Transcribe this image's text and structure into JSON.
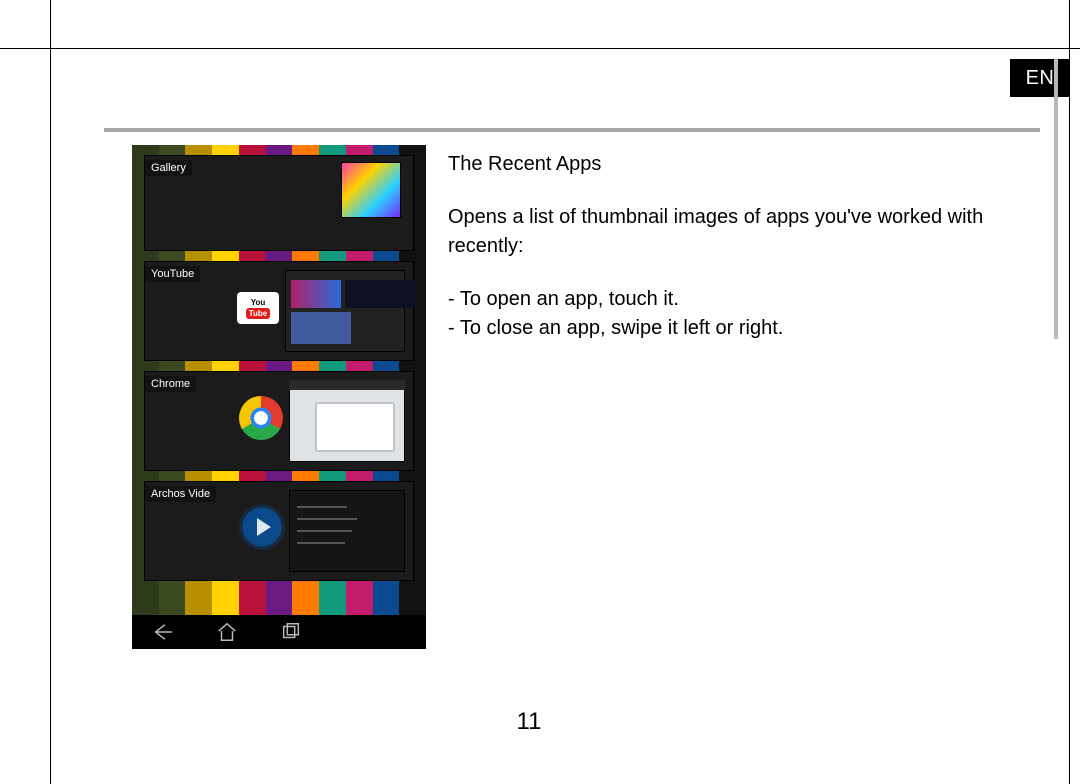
{
  "lang_badge": "EN",
  "page_number": "11",
  "heading": "The Recent Apps",
  "intro": "Opens a list of thumbnail images of apps you've worked with recently:",
  "bullets": [
    "-  To open an app, touch it.",
    "-  To close an app, swipe it left or right."
  ],
  "screenshot": {
    "cards": [
      {
        "label": "Gallery"
      },
      {
        "label": "YouTube"
      },
      {
        "label": "Chrome"
      },
      {
        "label": "Archos Vide"
      }
    ],
    "yt_text_top": "You",
    "yt_text_bottom": "Tube"
  }
}
